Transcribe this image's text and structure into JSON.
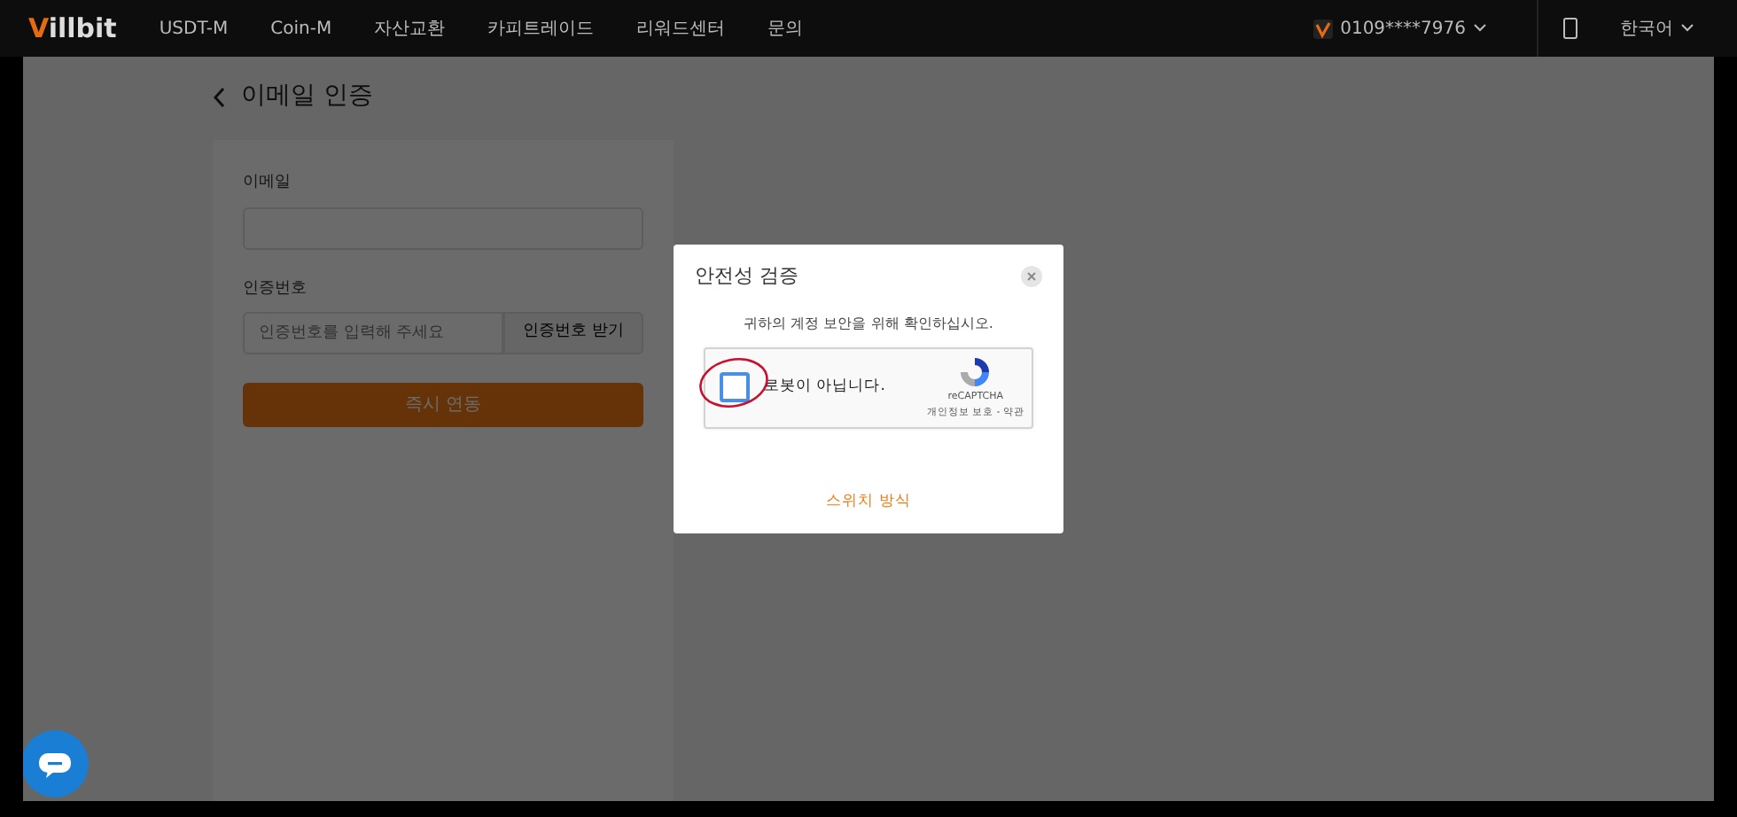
{
  "navbar": {
    "brand": "Villbit",
    "items": [
      "USDT-M",
      "Coin-M",
      "자산교환",
      "카피트레이드",
      "리워드센터",
      "문의"
    ],
    "account": "0109****7976",
    "language": "한국어"
  },
  "page": {
    "title": "이메일 인증",
    "fields": [
      {
        "kind": "plain",
        "label": "이메일"
      },
      {
        "kind": "code",
        "label": "인증번호",
        "placeholder": "인증번호를 입력해 주세요",
        "button": "인증번호 받기"
      }
    ],
    "submit": "즉시 연동"
  },
  "dialog": {
    "title": "안전성 검증",
    "message": "귀하의 계정 보안을 위해 확인하십시오.",
    "captcha": {
      "label": "로봇이 아닙니다.",
      "checked": false,
      "brand": "reCAPTCHA",
      "links": "개인정보 보호 - 약관"
    },
    "switch_link": "스위치 방식"
  }
}
